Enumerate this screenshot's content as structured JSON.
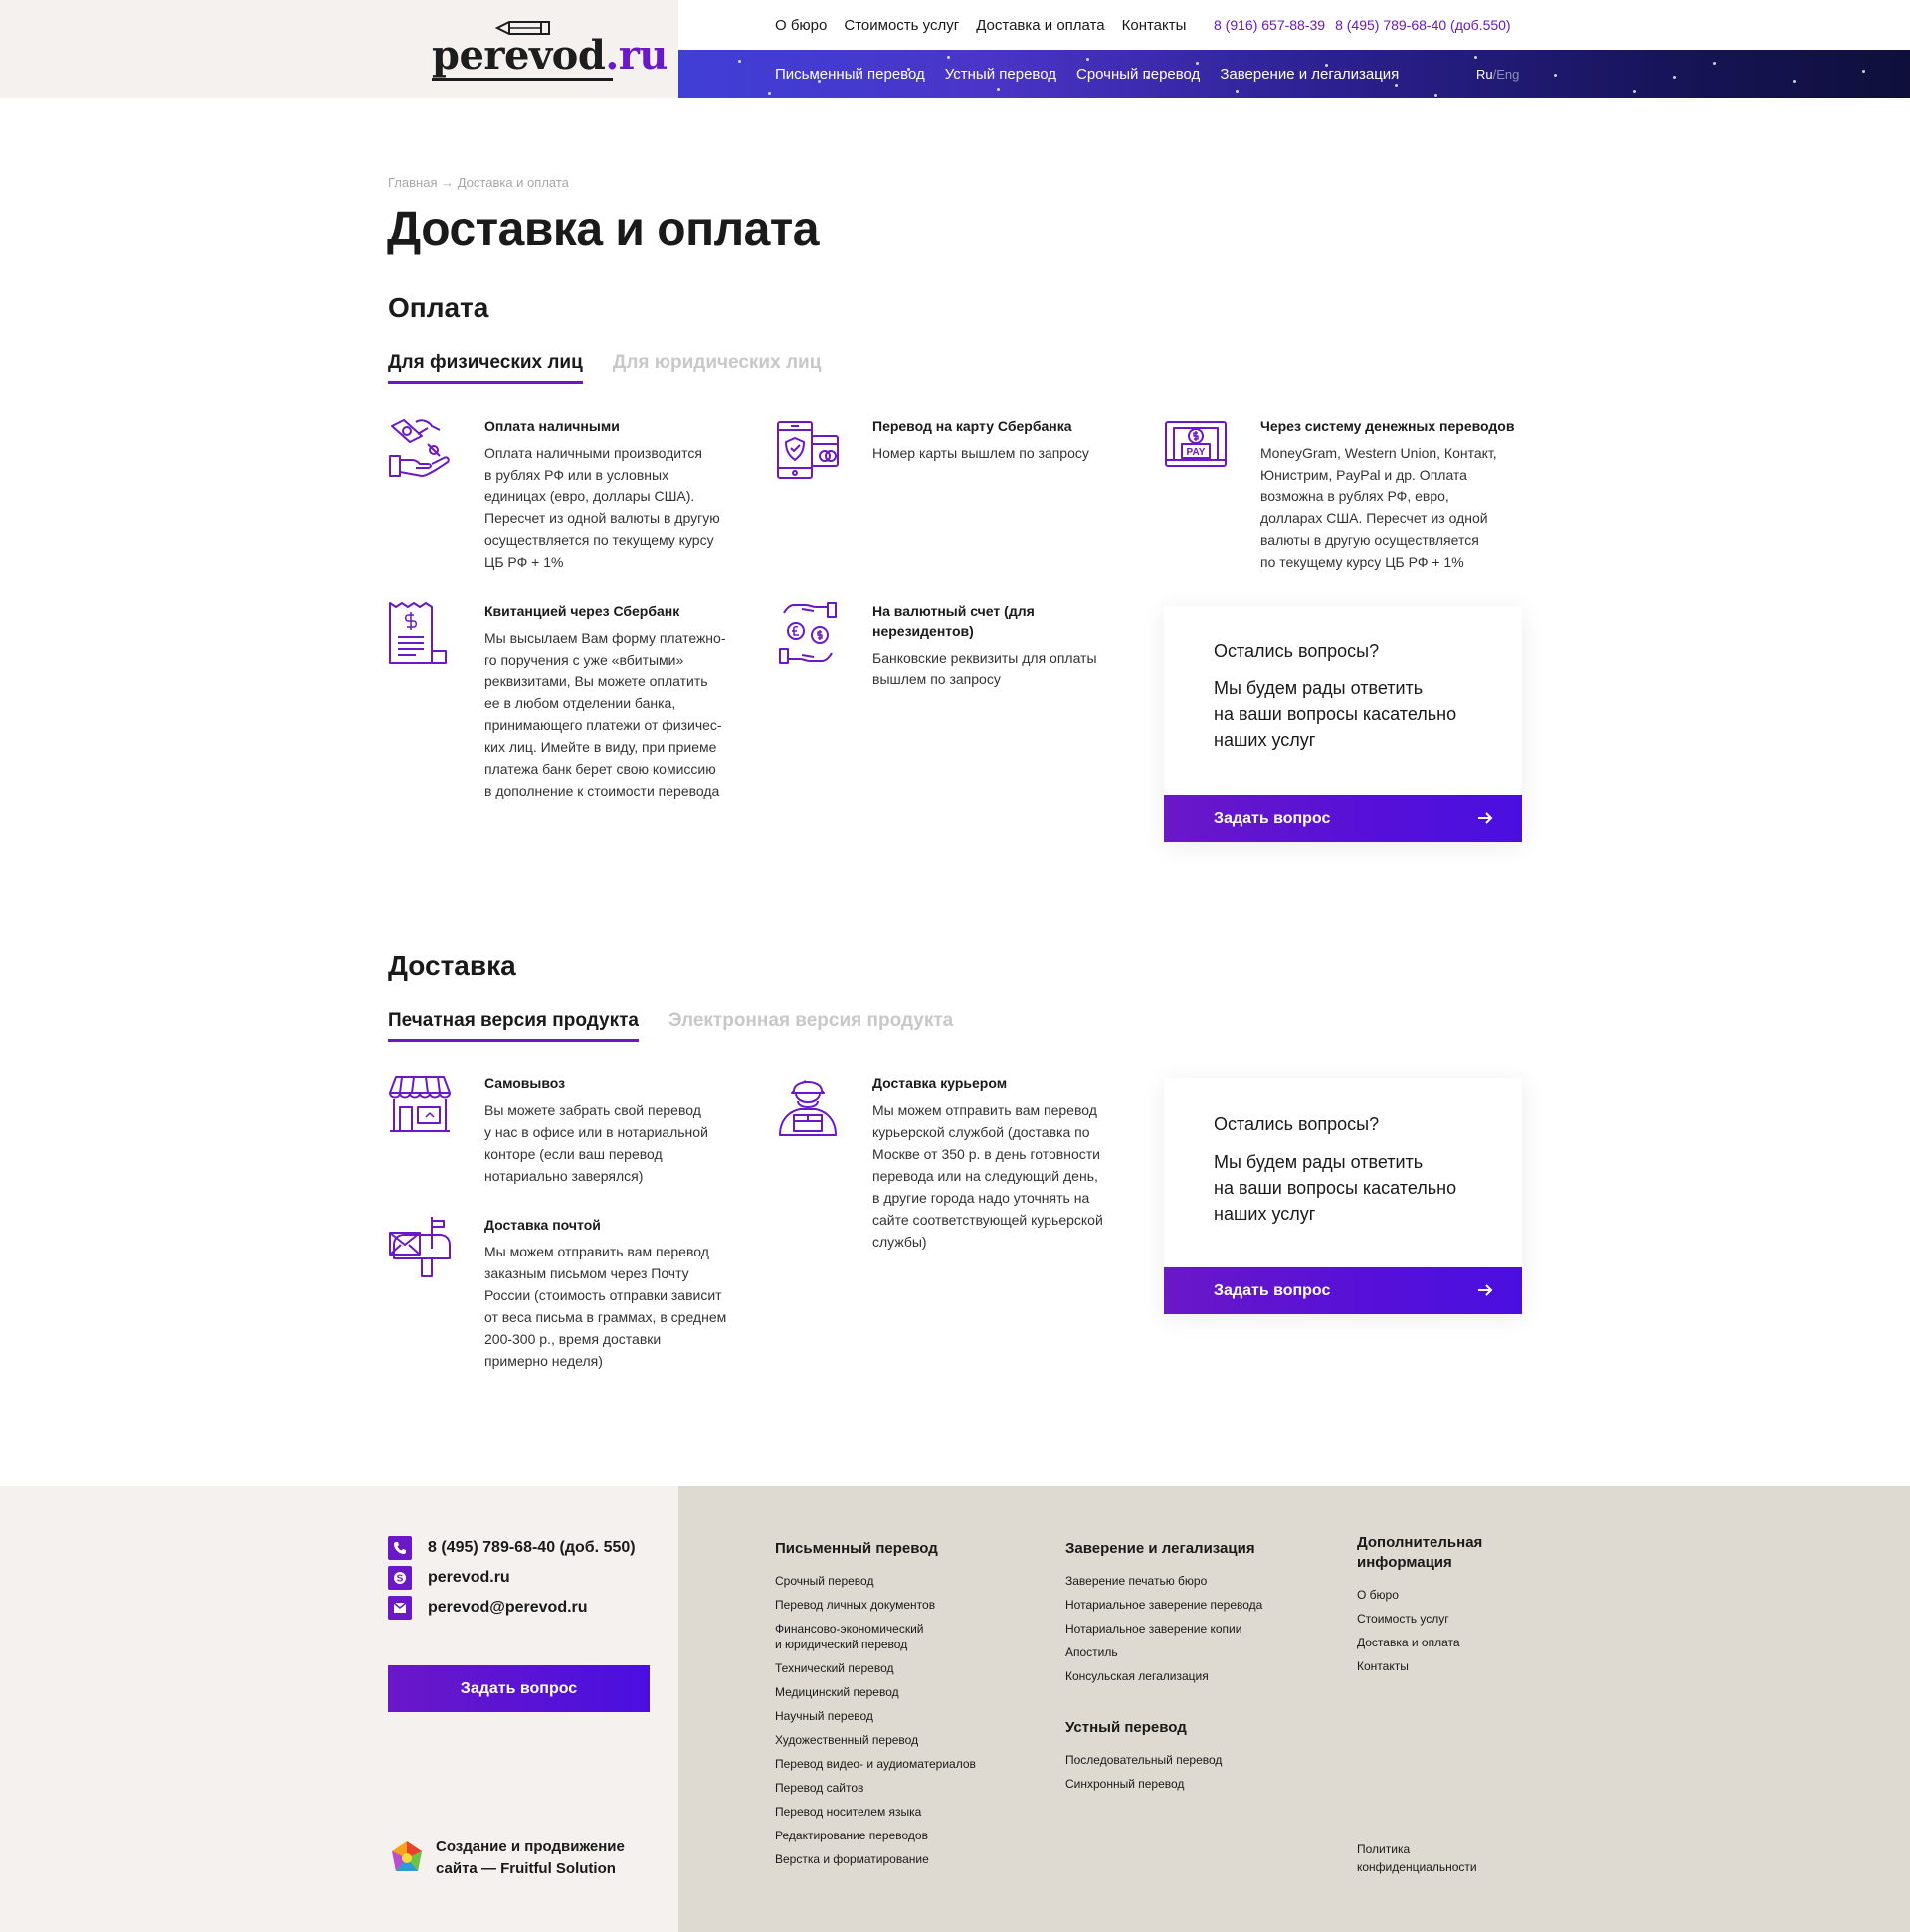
{
  "header": {
    "logo": {
      "name": "perevod",
      "suffix": ".ru"
    },
    "top_nav": [
      "О бюро",
      "Стоимость услуг",
      "Доставка и оплата",
      "Контакты"
    ],
    "phones": [
      "8 (916) 657-88-39",
      "8 (495) 789-68-40 (доб.550)"
    ],
    "service_nav": [
      "Письменный перевод",
      "Устный перевод",
      "Срочный перевод",
      "Заверение и легализация"
    ],
    "lang": {
      "ru": "Ru",
      "sep": "/",
      "eng": "Eng"
    }
  },
  "breadcrumb": {
    "home": "Главная",
    "sep": "→",
    "current": "Доставка и оплата"
  },
  "page_title": "Доставка и оплата",
  "payment": {
    "title": "Оплата",
    "tabs": [
      "Для физических лиц",
      "Для юридических лиц"
    ],
    "items": [
      {
        "title": "Оплата наличными",
        "desc": "Оплата наличными производится\nв рублях РФ или в условных\nединицах (евро, доллары США).\nПересчет из одной валюты в другую\nосуществляется по текущему курсу\nЦБ РФ + 1%",
        "icon": "cash-hand-icon"
      },
      {
        "title": "Перевод на карту Сбербанка",
        "desc": "Номер карты вышлем по запросу",
        "icon": "phone-card-icon"
      },
      {
        "title": "Через систему денежных переводов",
        "desc": "MoneyGram, Western Union, Контакт,\nЮнистрим, PayPal и др. Оплата\nвозможна в рублях РФ, евро,\nдолларах США. Пересчет из одной\nвалюты в другую осуществляется\nпо текущему курсу ЦБ РФ + 1%",
        "icon": "pay-monitor-icon"
      },
      {
        "title": "Квитанцией через Сбербанк",
        "desc": "Мы высылаем Вам форму платежно-\nго поручения с уже «вбитыми»\nреквизитами, Вы можете оплатить\nее в любом отделении банка,\nпринимающего платежи от физичес-\nких лиц. Имейте в виду, при приеме\nплатежа банк берет свою комиссию\nв дополнение к стоимости перевода",
        "icon": "receipt-icon"
      },
      {
        "title": "На валютный счет (для\nнерезидентов)",
        "desc": "Банковские реквизиты для оплаты\nвышлем по запросу",
        "icon": "currency-exchange-icon"
      }
    ]
  },
  "delivery": {
    "title": "Доставка",
    "tabs": [
      "Печатная версия продукта",
      "Электронная версия продукта"
    ],
    "items": [
      {
        "title": "Самовывоз",
        "desc": "Вы можете забрать свой перевод\nу нас в офисе или в нотариальной\nконторе (если ваш перевод\nнотариально заверялся)",
        "icon": "shop-icon"
      },
      {
        "title": "Доставка курьером",
        "desc": "Мы можем отправить вам перевод\nкурьерской службой (доставка по\nМоскве от 350 р. в день готовности\nперевода или на следующий день,\nв другие города надо уточнять на\nсайте соответствующей курьерской\nслужбы)",
        "icon": "courier-icon"
      },
      {
        "title": "Доставка почтой",
        "desc": "Мы можем отправить вам перевод\nзаказным письмом через Почту\nРоссии (стоимость отправки зависит\nот веса письма в граммах, в среднем\n200-300 р., время доставки\nпримерно неделя)",
        "icon": "mailbox-icon"
      }
    ]
  },
  "question_card": {
    "title": "Остались вопросы?",
    "text": "Мы будем рады ответить\nна ваши вопросы касательно\nнаших услуг",
    "button": "Задать вопрос"
  },
  "footer": {
    "phone": "8 (495) 789-68-40 (доб. 550)",
    "skype": "perevod.ru",
    "email": "perevod@perevod.ru",
    "button": "Задать вопрос",
    "credit": "Создание и продвижение\nсайта — Fruitful Solution",
    "col1": {
      "heading": "Письменный перевод",
      "links": [
        "Срочный перевод",
        "Перевод личных документов",
        "Финансово-экономический\nи юридический перевод",
        "Технический перевод",
        "Медицинский перевод",
        "Научный перевод",
        "Художественный перевод",
        "Перевод видео- и аудиоматериалов",
        "Перевод сайтов",
        "Перевод носителем языка",
        "Редактирование переводов",
        "Верстка и форматирование"
      ]
    },
    "col2": {
      "heading": "Заверение и легализация",
      "links": [
        "Заверение печатью бюро",
        "Нотариальное заверение перевода",
        "Нотариальное заверение копии",
        "Апостиль",
        "Консульская легализация"
      ],
      "heading2": "Устный перевод",
      "links2": [
        "Последовательный перевод",
        "Синхронный перевод"
      ]
    },
    "col3": {
      "heading": "Дополнительная\nинформация",
      "links": [
        "О бюро",
        "Стоимость услуг",
        "Доставка и оплата",
        "Контакты"
      ],
      "privacy": "Политика\nконфиденциальности"
    }
  },
  "colors": {
    "accent": "#6a18c8",
    "footer_left": "#f4f1ee",
    "footer_right": "#ded9d1"
  }
}
